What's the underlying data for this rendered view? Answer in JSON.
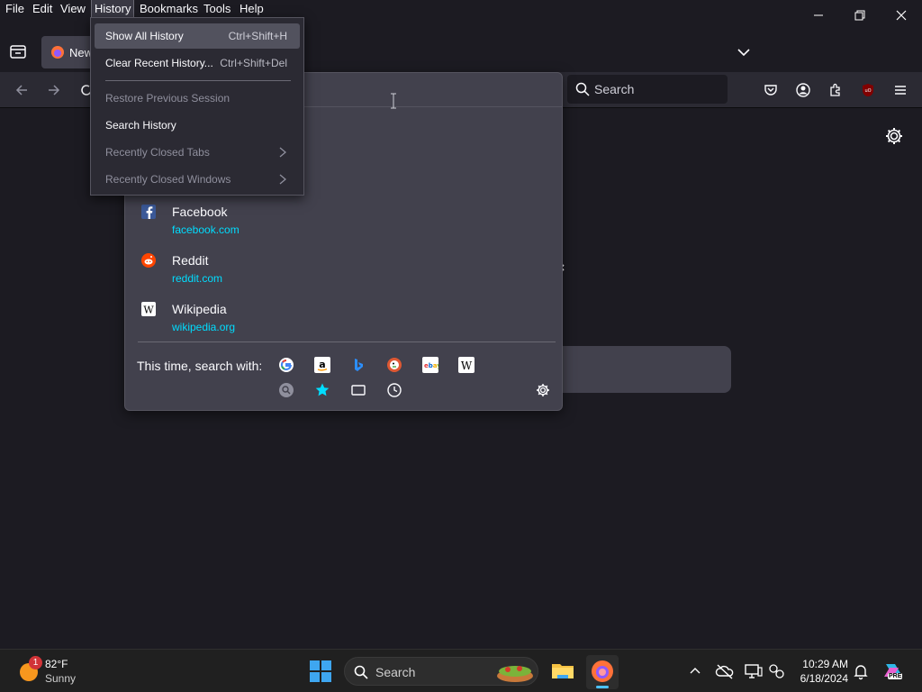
{
  "menubar": {
    "items": [
      "File",
      "Edit",
      "View",
      "History",
      "Bookmarks",
      "Tools",
      "Help"
    ]
  },
  "tabstrip": {
    "tab_title": "New"
  },
  "navbar": {
    "search_placeholder": "Search"
  },
  "history_menu": {
    "items": [
      {
        "label": "Show All History",
        "shortcut": "Ctrl+Shift+H"
      },
      {
        "label": "Clear Recent History...",
        "shortcut": "Ctrl+Shift+Del"
      },
      {
        "label": "Restore Previous Session"
      },
      {
        "label": "Search History"
      },
      {
        "label": "Recently Closed Tabs"
      },
      {
        "label": "Recently Closed Windows"
      }
    ]
  },
  "url_dropdown": {
    "sites": [
      {
        "name": "Facebook",
        "url": "facebook.com"
      },
      {
        "name": "Reddit",
        "url": "reddit.com"
      },
      {
        "name": "Wikipedia",
        "url": "wikipedia.org"
      }
    ],
    "search_with_label": "This time, search with:",
    "engines": [
      "google-icon",
      "amazon-icon",
      "bing-icon",
      "duckduckgo-icon",
      "ebay-icon",
      "wikipedia-icon"
    ],
    "modes": [
      "search-icon",
      "bookmarks-star-icon",
      "tabs-icon",
      "history-clock-icon"
    ]
  },
  "taskbar": {
    "weather_temp": "82°F",
    "weather_cond": "Sunny",
    "weather_badge": "1",
    "search_placeholder": "Search",
    "time": "10:29 AM",
    "date": "6/18/2024",
    "copilot_badge": "PRE"
  },
  "colors": {
    "accent_cyan": "#00ddff",
    "menu_bg": "#2b2a33",
    "dropdown_bg": "#42414d",
    "page_bg": "#1c1b22"
  }
}
